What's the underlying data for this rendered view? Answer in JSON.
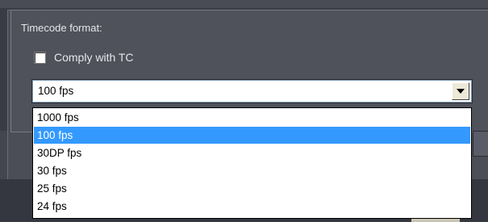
{
  "timecode": {
    "section_label": "Timecode format:",
    "comply_checkbox_label": "Comply with TC",
    "comply_checked": false,
    "selected_value": "100 fps",
    "options": [
      "1000 fps",
      "100 fps",
      "30DP fps",
      "30 fps",
      "25 fps",
      "24 fps"
    ],
    "highlighted_option": "100 fps",
    "highlight_color": "#3399ff"
  },
  "icons": {
    "combo_arrow": "chevron-down-icon"
  }
}
